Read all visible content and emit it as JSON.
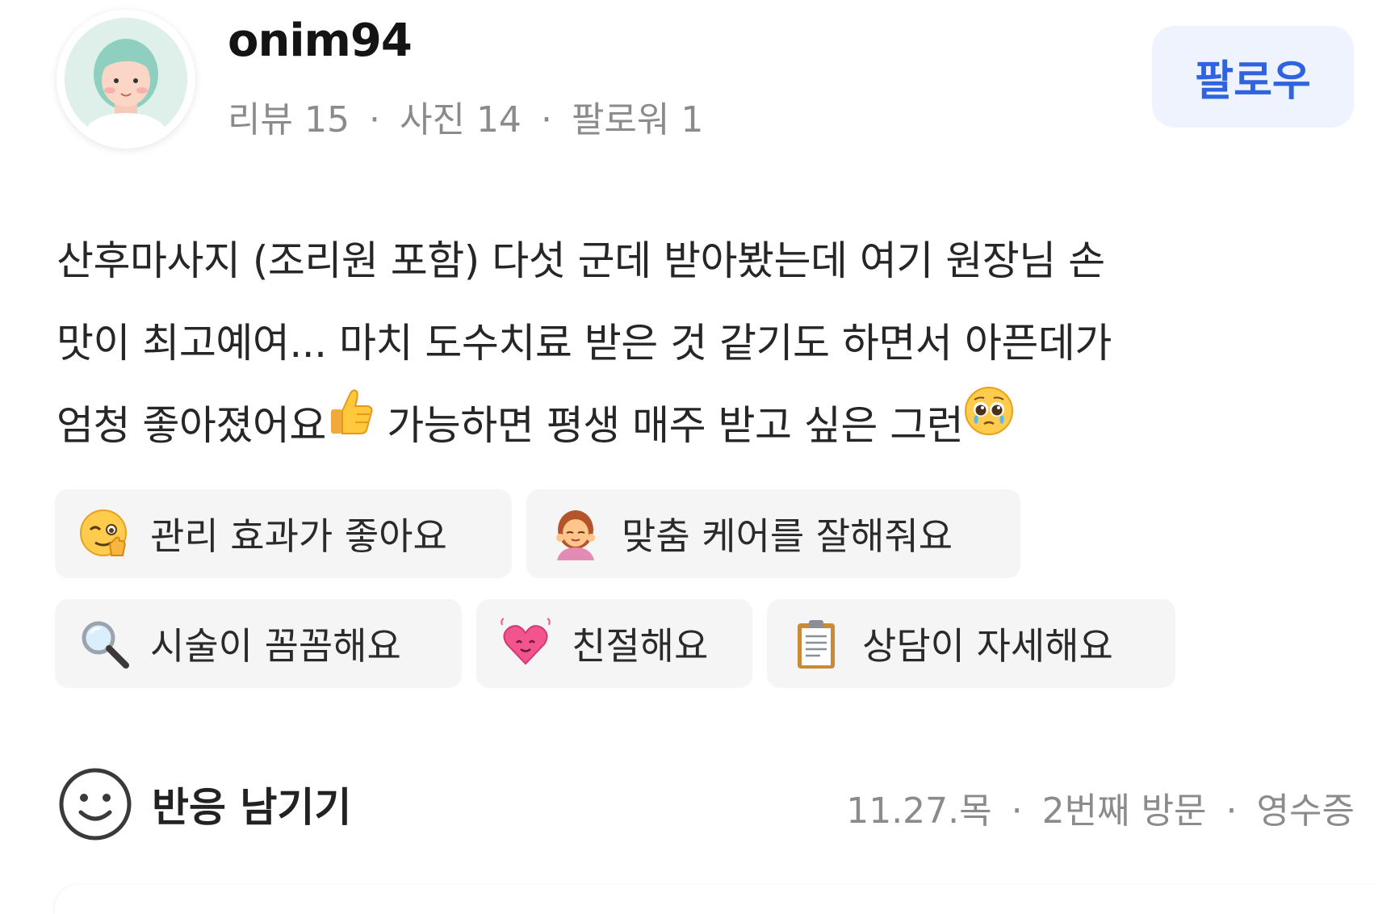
{
  "profile": {
    "username": "onim94",
    "stats": [
      {
        "label": "리뷰",
        "value": "15"
      },
      {
        "label": "사진",
        "value": "14"
      },
      {
        "label": "팔로워",
        "value": "1"
      }
    ],
    "follow_label": "팔로우"
  },
  "review": {
    "lines": [
      "산후마사지 (조리원 포함) 다섯 군데 받아봤는데 여기 원장님 손",
      "맛이 최고예여... 마치 도수치료 받은 것 같기도 하면서 아픈데가",
      "엄청 좋아졌어요",
      " 가능하면 평생 매주 받고 싶은 그런"
    ],
    "emojis": [
      "thumbs-up",
      "pleading-face"
    ]
  },
  "tags": [
    {
      "icon": "winking-thumbs-icon",
      "label": "관리 효과가 좋아요"
    },
    {
      "icon": "woman-facial-icon",
      "label": "맞춤 케어를 잘해줘요"
    },
    {
      "icon": "magnifier-icon",
      "label": "시술이 꼼꼼해요"
    },
    {
      "icon": "beating-heart-icon",
      "label": "친절해요"
    },
    {
      "icon": "clipboard-icon",
      "label": "상담이 자세해요"
    }
  ],
  "footer": {
    "react_label": "반응 남기기",
    "date": "11.27.목",
    "visit": "2번째 방문",
    "proof": "영수증"
  },
  "colors": {
    "accent": "#2f63e0",
    "follow_bg": "#eef3fe",
    "tag_bg": "#f5f5f5",
    "muted_text": "#8b8b8b"
  }
}
